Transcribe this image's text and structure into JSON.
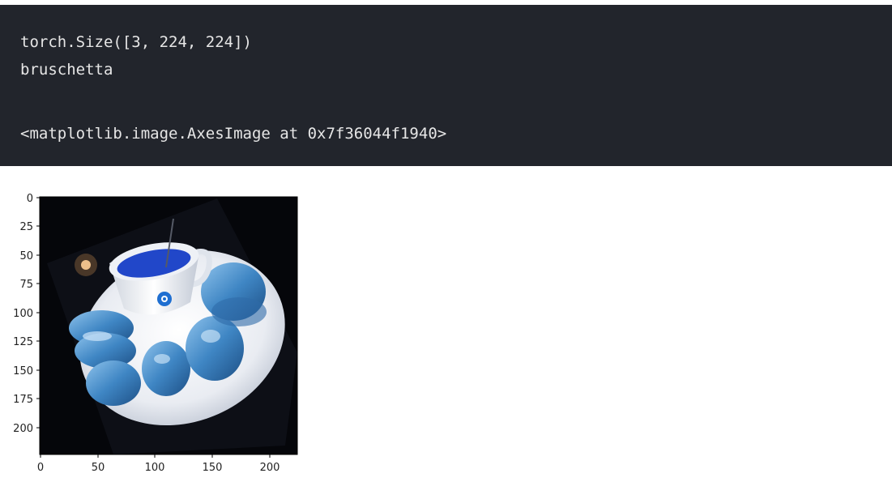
{
  "output": {
    "lines": [
      "torch.Size([3, 224, 224])",
      "bruschetta",
      "<matplotlib.image.AxesImage at 0x7f36044f1940>"
    ],
    "background_color": "#22252c",
    "text_color": "#e6e6e6"
  },
  "plot": {
    "x_ticks": [
      "0",
      "50",
      "100",
      "150",
      "200"
    ],
    "y_ticks": [
      "0",
      "25",
      "50",
      "75",
      "100",
      "125",
      "150",
      "175",
      "200"
    ],
    "image_subject": "rotated photo of a blue-tinted bruschetta plate with a coffee cup on dark background",
    "image_size": [
      224,
      224
    ]
  }
}
